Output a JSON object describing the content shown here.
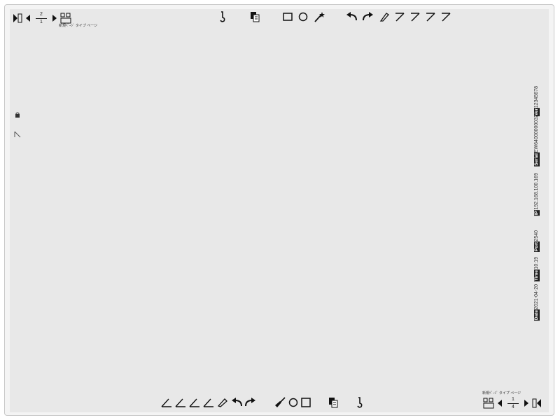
{
  "top_left": {
    "page_current": "2",
    "page_total": "1",
    "caption": "新規ﾍﾟｰｼﾞ タイプ ページ"
  },
  "bottom_right": {
    "page_current": "1",
    "page_total": "4",
    "caption": "新規ﾍﾟｰｼﾞ タイプ ページ"
  },
  "info_panel": [
    {
      "label": "Ver",
      "value": "12345678"
    },
    {
      "label": "Serial",
      "value": "EW64000000032"
    },
    {
      "label": "IP",
      "value": "192.168.100.169"
    },
    {
      "label": "Port",
      "value": "2540"
    },
    {
      "label": "Time",
      "value": "10:19"
    },
    {
      "label": "Date",
      "value": "2021-04-20"
    }
  ],
  "colors": {
    "background": "#e8e8e8",
    "bezel": "#f4f4f4",
    "icon": "#111111"
  },
  "icons": {
    "top_toolbar": [
      "tool-icon",
      "page-stack-icon",
      "rectangle-icon",
      "circle-icon",
      "magic-wand-icon",
      "undo-icon",
      "redo-icon",
      "eraser-icon",
      "pen-icon",
      "pen-icon",
      "pen-icon",
      "pen-icon"
    ],
    "bottom_toolbar": [
      "pen-icon",
      "pen-icon",
      "pen-icon",
      "pen-icon",
      "highlighter-icon",
      "undo-icon",
      "redo-icon",
      "broom-icon",
      "circle-icon",
      "rectangle-icon",
      "page-stack-icon",
      "tool-icon"
    ]
  }
}
